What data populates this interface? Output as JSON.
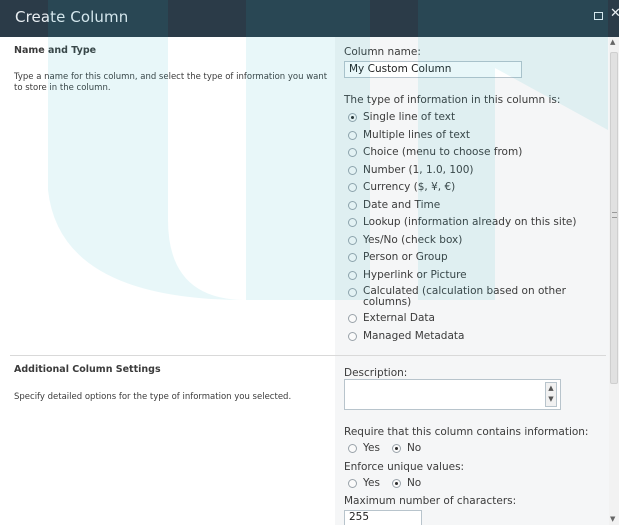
{
  "window": {
    "title": "Create Column",
    "maximize_icon": "maximize-icon",
    "close_icon": "close-icon"
  },
  "sections": {
    "name_type": {
      "title": "Name and Type",
      "description": "Type a name for this column, and select the type of information you want to store in the column."
    },
    "additional": {
      "title": "Additional Column Settings",
      "description": "Specify detailed options for the type of information you selected."
    }
  },
  "form": {
    "column_name_label": "Column name:",
    "column_name_value": "My Custom Column",
    "type_label": "The type of information in this column is:",
    "types": [
      {
        "label": "Single line of text",
        "checked": true
      },
      {
        "label": "Multiple lines of text",
        "checked": false
      },
      {
        "label": "Choice (menu to choose from)",
        "checked": false
      },
      {
        "label": "Number (1, 1.0, 100)",
        "checked": false
      },
      {
        "label": "Currency ($, ¥, €)",
        "checked": false
      },
      {
        "label": "Date and Time",
        "checked": false
      },
      {
        "label": "Lookup (information already on this site)",
        "checked": false
      },
      {
        "label": "Yes/No (check box)",
        "checked": false
      },
      {
        "label": "Person or Group",
        "checked": false
      },
      {
        "label": "Hyperlink or Picture",
        "checked": false
      },
      {
        "label": "Calculated (calculation based on other columns)",
        "checked": false
      },
      {
        "label": "External Data",
        "checked": false
      },
      {
        "label": "Managed Metadata",
        "checked": false
      }
    ],
    "description_label": "Description:",
    "description_value": "",
    "require_label": "Require that this column contains information:",
    "require_yes": "Yes",
    "require_no": "No",
    "require_selected": "No",
    "unique_label": "Enforce unique values:",
    "unique_yes": "Yes",
    "unique_no": "No",
    "unique_selected": "No",
    "max_chars_label": "Maximum number of characters:",
    "max_chars_value": "255"
  },
  "colors": {
    "titlebar": "#2b3b48",
    "panel": "#f5f6f7",
    "watermark": "#21b3c4"
  }
}
